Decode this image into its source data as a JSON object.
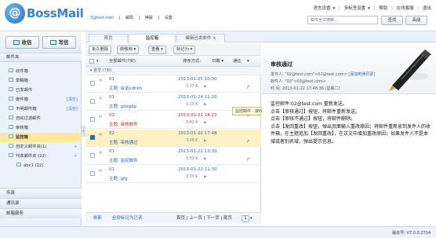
{
  "header": {
    "logo_text": "BossMail",
    "logo_letter": "@",
    "user_email": "3@test.com",
    "user_links": [
      "| ",
      "邮局",
      "| ",
      "换肤",
      "| ",
      "设置"
    ],
    "top_links": [
      "语言设置",
      "▾",
      "|",
      "多标签设置",
      "▾",
      "|",
      "帮助",
      "|",
      "在线客服",
      "|",
      "退出"
    ],
    "search_placeholder": "邮件全文搜索...",
    "search_button": "查找",
    "advanced_button": "高级"
  },
  "sidebar": {
    "receive_label": "收信",
    "write_label": "写信",
    "folders_title": "邮件夹",
    "folders": [
      {
        "label": "收件箱"
      },
      {
        "label": "草稿箱"
      },
      {
        "label": "已发邮件"
      },
      {
        "label": "废件箱",
        "actions": "[清空]"
      },
      {
        "label": "不明邮件箱",
        "actions": "[清空]"
      },
      {
        "label": "自动过滤邮件"
      },
      {
        "label": "审核箱"
      },
      {
        "label": "监控箱"
      },
      {
        "label": "自定义邮件夹(1)"
      },
      {
        "label": "代收邮件夹 (22)"
      },
      {
        "label": "abc1 (22)"
      }
    ],
    "bottom_items": [
      "传真",
      "通讯录",
      "邮箱服务"
    ]
  },
  "tabs": [
    {
      "label": "首页"
    },
    {
      "label": "监控箱"
    },
    {
      "label": "编辑已发邮件"
    }
  ],
  "list": {
    "toolbar": {
      "delete": "永久删除",
      "move": "转移到 ▾",
      "view": "查看 ▾",
      "mark": "标记为 ▾"
    },
    "header": {
      "select_all": "全部邮件(7封)",
      "sort_label": "排序方式:",
      "sort_value": "日期 ▾",
      "pager": "通往"
    },
    "group_label": "▾ 更早 (7封)",
    "emails": [
      {
        "sender": "01",
        "subject": "主题: 会话sdhkh",
        "date": "2013-01-25 10:30",
        "size": "3.27 K"
      },
      {
        "sender": "01",
        "subject": "主题: gdsgdg",
        "date": "2013-01-24 11:20",
        "size": "3.23 K"
      },
      {
        "sender": "03",
        "subject": "主题: 审核邮件",
        "date": "2013-01-21 14:22",
        "size": "3.43 K"
      },
      {
        "sender": "02",
        "subject": "主题: 审核通过",
        "date": "2013-01-22 17:48",
        "size": "3.36 K"
      },
      {
        "sender": "01",
        "subject": "主题: 监控邮件",
        "date": "2013-01-22 13:30",
        "size": "3.33 K"
      },
      {
        "sender": "01",
        "subject": "主题: gfg",
        "date": "2013-01-22 11:30",
        "size": "3.33 K"
      }
    ],
    "tooltip": "监控邮件 - 接收的邮件",
    "footer": {
      "refresh": "刷新",
      "mark_all_read": "全部标记为已读",
      "pages": "首页 | 上一页 | 下一页 | 尾页",
      "page_num": "1",
      "page_arrow": "▾"
    }
  },
  "preview": {
    "title": "审核通过",
    "from_label": "发件人:",
    "from_value": "\"02@test.com\"<02@test.com>",
    "from_link": "[添加到通讯录]",
    "to_label": "收件人:",
    "to_value": "\"03\"<03@test.com>",
    "time_label": "时   间:",
    "time_value": "2013-01-22 17:48:36 (星期二)",
    "body_lines": [
      "监控邮件:02@test.com 重新发送。",
      "点击【审核通过】按钮，将邮件重新发送。",
      "点击【审核不通过】按钮，将邮件删除。",
      "点击【发回重改】按钮，弹出页面输入重改原因；将邮件重新放到发件人的收件箱，在主题追加【发回重改】，在正文中增加重改原因；如果发件人不是本域或者别名域，弹出提示信息。"
    ]
  },
  "footer": {
    "version": "版本号: V7.0.0.2714"
  },
  "colors": {
    "accent": "#2a68b8",
    "selected_row": "#fdf1c6",
    "active_folder": "#fde89d",
    "unread_red": "#e02020",
    "sidebar_bg": "#eaf2fb"
  }
}
